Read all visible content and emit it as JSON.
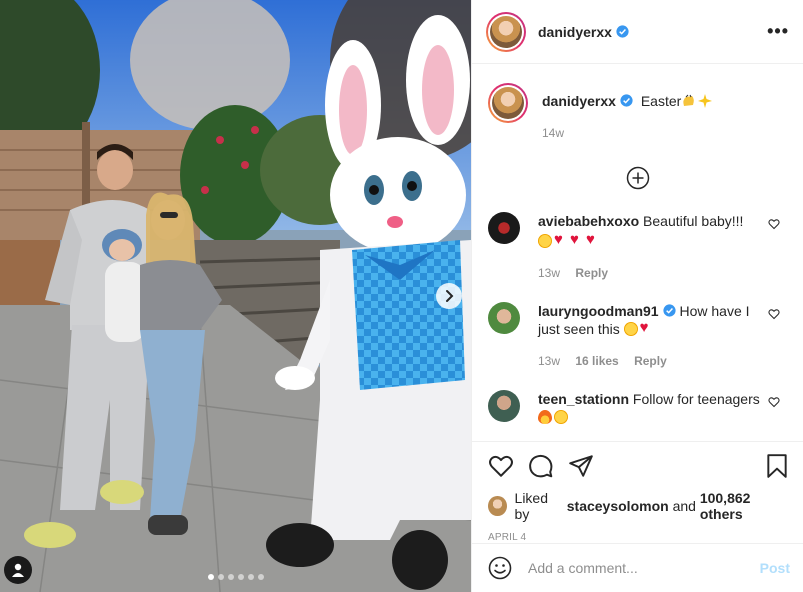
{
  "post": {
    "author": "danidyerxx",
    "caption_text": "Easter",
    "caption_emojis": [
      "clapping-hands",
      "sparkles"
    ],
    "time_ago": "14w",
    "carousel_dots": 6,
    "carousel_active_index": 0
  },
  "comments": [
    {
      "username": "aviebabehxoxo",
      "text": "Beautiful baby!!!",
      "emojis": [
        "star-struck",
        "red-heart",
        "red-heart",
        "red-heart"
      ],
      "time": "13w",
      "likes": "",
      "reply_label": "Reply",
      "avatar_color": "#1a1a1a"
    },
    {
      "username": "lauryngoodman91",
      "verified": true,
      "text": "How have I just seen this",
      "emojis": [
        "star-struck",
        "red-heart"
      ],
      "time": "13w",
      "likes": "16 likes",
      "reply_label": "Reply",
      "avatar_color": "#5e9a4f"
    },
    {
      "username": "teen_stationn",
      "text": "Follow for teenagers",
      "emojis": [
        "fire",
        "star-struck"
      ],
      "avatar_color": "#4f6b5e"
    }
  ],
  "likes": {
    "prefix": "Liked by",
    "liker": "staceysolomon",
    "conjunction": "and",
    "others": "100,862 others"
  },
  "date": "APRIL 4",
  "add_comment": {
    "placeholder": "Add a comment...",
    "post_label": "Post"
  },
  "colors": {
    "link_blue": "#0095f6",
    "post_disabled": "#b2dffc",
    "heart_red": "#e0143c",
    "muted_text": "#8e8e8e",
    "border": "#efefef"
  }
}
